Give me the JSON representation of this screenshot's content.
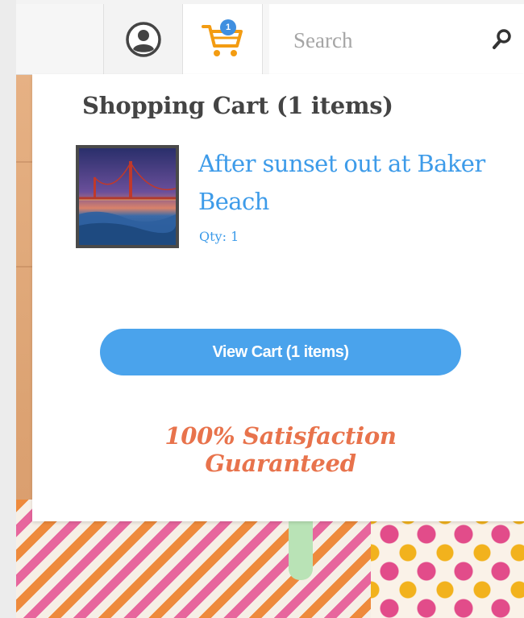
{
  "header": {
    "search": {
      "placeholder": "Search",
      "value": ""
    },
    "cart": {
      "badge_count": "1"
    },
    "colors": {
      "cart_icon": "#f39c12",
      "badge": "#3f8fe0"
    }
  },
  "cart_dropdown": {
    "title": "Shopping Cart (1 items)",
    "items": [
      {
        "name": "After sunset out at Baker Beach",
        "qty_label": "Qty: 1",
        "thumbnail_icon": "golden-gate-bridge-photo"
      }
    ],
    "view_cart_label": "View Cart (1 items)",
    "guarantee": {
      "line1": "100% Satisfaction",
      "line2": "Guaranteed"
    },
    "colors": {
      "link": "#3d9be9",
      "button": "#4aa3ec",
      "guarantee": "#e8734c"
    }
  }
}
